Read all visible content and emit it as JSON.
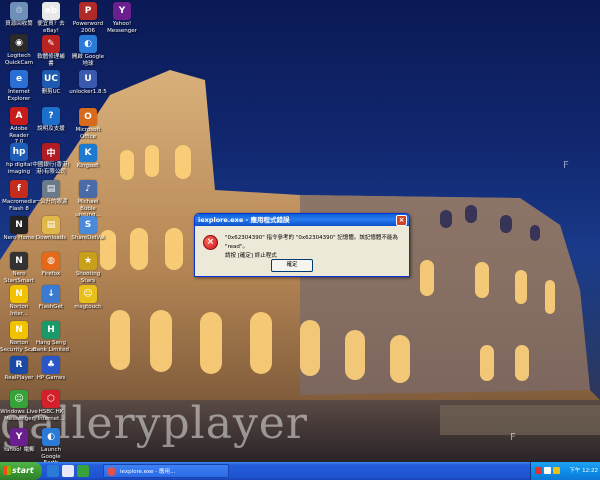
{
  "desktop": {
    "watermark": "galleryplayer",
    "edge_letter": "F",
    "icons": [
      {
        "label": "資源回收筒",
        "color": "#6d8fb8",
        "glyph": "♲"
      },
      {
        "label": "Logitech\nQuickCam",
        "color": "#2a2a2a",
        "glyph": "◉"
      },
      {
        "label": "Internet\nExplorer",
        "color": "#2a6fd6",
        "glyph": "e"
      },
      {
        "label": "Adobe Reader\n7.0",
        "color": "#c81c1c",
        "glyph": "A"
      },
      {
        "label": "hp digital\nimaging",
        "color": "#1d5fb8",
        "glyph": "hp"
      },
      {
        "label": "Macromedia\nFlash 8",
        "color": "#c62c1c",
        "glyph": "f"
      },
      {
        "label": "Nero Home",
        "color": "#222",
        "glyph": "N"
      },
      {
        "label": "Nero\nStartSmart",
        "color": "#333",
        "glyph": "N"
      },
      {
        "label": "Norton\nInter...",
        "color": "#f2c200",
        "glyph": "N"
      },
      {
        "label": "Norton\nSecurity Scan",
        "color": "#f2c200",
        "glyph": "N"
      },
      {
        "label": "RealPlayer",
        "color": "#1b4aa6",
        "glyph": "R"
      },
      {
        "label": "Windows Live\nMessenger",
        "color": "#37a23a",
        "glyph": "☺"
      },
      {
        "label": "Yahoo! 電郵",
        "color": "#6b1f8f",
        "glyph": "Y"
      },
      {
        "label": "便宜買？去\neBay!",
        "color": "#e8e8e8",
        "glyph": "eb"
      },
      {
        "label": "軟體修理補\n書",
        "color": "#b22",
        "glyph": "✎"
      },
      {
        "label": "刪剪UC",
        "color": "#1e5bb0",
        "glyph": "UC"
      },
      {
        "label": "說明及支援",
        "color": "#1c6fc8",
        "glyph": "?"
      },
      {
        "label": "中國銀行(香港)\n港)有限公司",
        "color": "#b01c22",
        "glyph": "中"
      },
      {
        "label": "一公升的眼淚",
        "color": "#6b7a8a",
        "glyph": "▤"
      },
      {
        "label": "Downloads",
        "color": "#e0b84a",
        "glyph": "▤"
      },
      {
        "label": "Firefox",
        "color": "#e46a1a",
        "glyph": "◍"
      },
      {
        "label": "FlashGet",
        "color": "#3a7ad0",
        "glyph": "↓"
      },
      {
        "label": "Hang Seng\nBank Limited",
        "color": "#1a9a6a",
        "glyph": "H"
      },
      {
        "label": "HP Games",
        "color": "#2a56c8",
        "glyph": "♣"
      },
      {
        "label": "HSBC HK\nInternet...",
        "color": "#d4202a",
        "glyph": "⬡"
      },
      {
        "label": "Launch Google\nEarth",
        "color": "#2a7ad8",
        "glyph": "◐"
      },
      {
        "label": "Powerword\n2006",
        "color": "#b02a2a",
        "glyph": "P"
      },
      {
        "label": "開啟 Google\n地球",
        "color": "#2a7ad8",
        "glyph": "◐"
      },
      {
        "label": "unlocker1.8.5",
        "color": "#3a5ab0",
        "glyph": "U"
      },
      {
        "label": "Microsoft Office",
        "color": "#d86a1c",
        "glyph": "O"
      },
      {
        "label": "Kingsoft",
        "color": "#1c7ad0",
        "glyph": "K"
      },
      {
        "label": "Michael Buble\nunsung...",
        "color": "#4a6aa8",
        "glyph": "♪"
      },
      {
        "label": "ShareDelVal",
        "color": "#4a8ad8",
        "glyph": "S"
      },
      {
        "label": "Shooting Stars",
        "color": "#c8a01c",
        "glyph": "★"
      },
      {
        "label": "msgtouch",
        "color": "#e8c01c",
        "glyph": "☺"
      },
      {
        "label": "Yahoo!\nMessenger",
        "color": "#6b1f8f",
        "glyph": "Y"
      }
    ]
  },
  "dialog": {
    "title": "iexplore.exe - 應用程式錯誤",
    "close_glyph": "×",
    "error_glyph": "×",
    "message_line1": "\"0x62304390\" 指令參考的 \"0x62304390\" 記憶體。該記憶體不能為 \"read\"。",
    "message_line2": "請按 [確定] 終止程式",
    "ok_label": "確定"
  },
  "taskbar": {
    "start_label": "start",
    "task_label": "iexplore.exe - 應用...",
    "clock": "下午 12:22"
  }
}
